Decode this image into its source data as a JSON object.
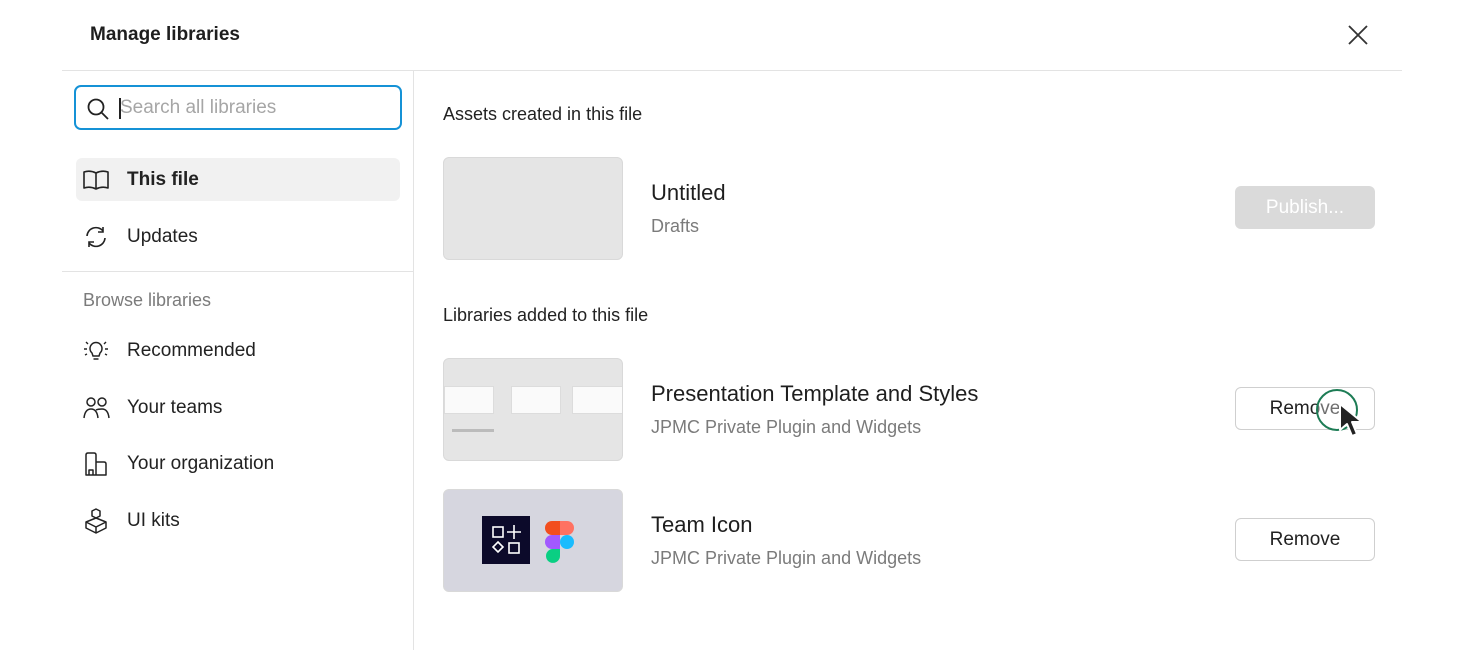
{
  "dialog": {
    "title": "Manage libraries",
    "close_icon": "close-icon"
  },
  "search": {
    "placeholder": "Search all libraries",
    "value": ""
  },
  "sidebar": {
    "primary_items": [
      {
        "label": "This file",
        "icon": "book-icon",
        "active": true
      },
      {
        "label": "Updates",
        "icon": "refresh-icon",
        "active": false
      }
    ],
    "browse_heading": "Browse libraries",
    "browse_items": [
      {
        "label": "Recommended",
        "icon": "lightbulb-icon"
      },
      {
        "label": "Your teams",
        "icon": "people-icon"
      },
      {
        "label": "Your organization",
        "icon": "building-icon"
      },
      {
        "label": "UI kits",
        "icon": "package-icon"
      }
    ]
  },
  "main": {
    "assets_heading": "Assets created in this file",
    "current_file": {
      "name": "Untitled",
      "location": "Drafts",
      "action": "Publish..."
    },
    "libraries_heading": "Libraries added to this file",
    "libraries": [
      {
        "name": "Presentation Template and Styles",
        "org": "JPMC Private Plugin and Widgets",
        "action": "Remove"
      },
      {
        "name": "Team Icon",
        "org": "JPMC Private Plugin and Widgets",
        "action": "Remove"
      }
    ]
  },
  "colors": {
    "focus": "#1592d6",
    "active_bg": "#f1f1f1",
    "cursor_ring": "#1d7c55",
    "team_badge": "#0c0a2a"
  }
}
